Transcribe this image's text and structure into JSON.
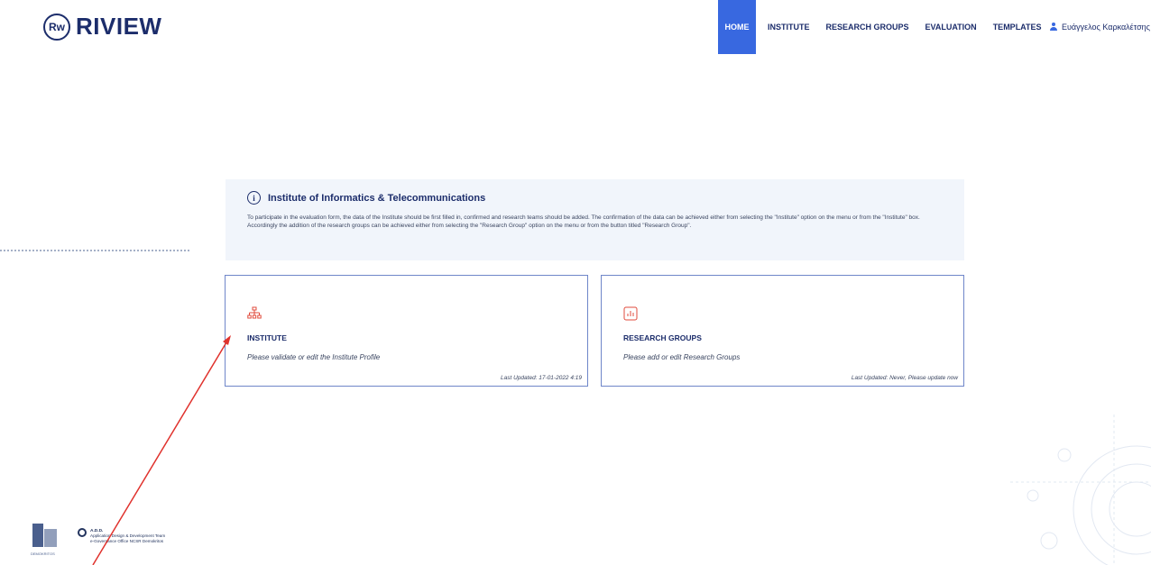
{
  "header": {
    "logo_badge": "Rw",
    "logo_text": "RIVIEW",
    "nav": [
      {
        "label": "HOME",
        "active": true
      },
      {
        "label": "INSTITUTE"
      },
      {
        "label": "RESEARCH GROUPS"
      },
      {
        "label": "EVALUATION"
      },
      {
        "label": "TEMPLATES"
      }
    ],
    "user_name": "Ευάγγελος Καρκαλέτσης",
    "user_chevron": "⌄"
  },
  "info": {
    "icon": "i",
    "title": "Institute of Informatics & Telecommunications",
    "text": "To participate in the evaluation form, the data of the Institute should be first filled in, confirmed and research teams should be added. The confirmation of the data can be achieved either from selecting the \"Institute\" option on the menu or from the \"Institute\" box. Accordingly the addition of the research groups can be achieved either from selecting the \"Research Group\" option on the menu or from the button titled \"Research Group\"."
  },
  "cards": [
    {
      "icon": "sitemap-icon",
      "title": "INSTITUTE",
      "desc": "Please validate or edit the Institute Profile",
      "updated": "Last Updated: 17-01-2022 4:19"
    },
    {
      "icon": "chart-icon",
      "title": "RESEARCH GROUPS",
      "desc": "Please add or edit Research Groups",
      "updated": "Last Updated: Never, Please update now"
    }
  ],
  "footer": {
    "demokritos_label": "DEMOKRITOS",
    "add_title": "A.D.D.",
    "add_line1": "Application Design & Development Team",
    "add_line2": "e-Governance Office NCSR Demokritos"
  },
  "colors": {
    "accent": "#3868e0",
    "brand": "#1c2d6b",
    "icon_red": "#e04b3c",
    "arrow": "#e0322d"
  }
}
